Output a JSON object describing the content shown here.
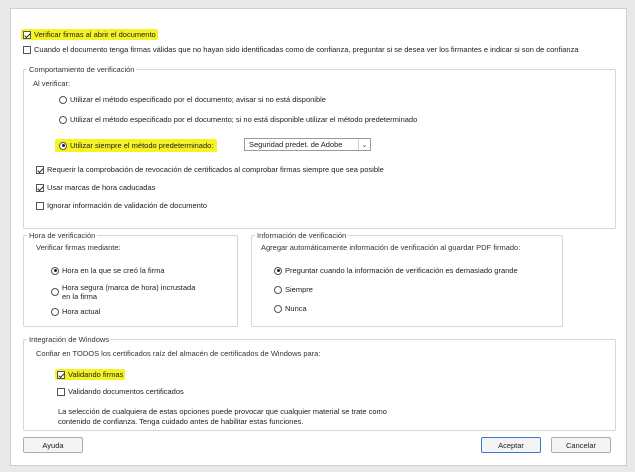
{
  "top_checkbox": {
    "label": "Verificar firmas al abrir el documento",
    "checked": true
  },
  "second_checkbox": {
    "label": "Cuando el documento tenga firmas válidas que no hayan sido identificadas como de confianza, preguntar si se desea ver los firmantes e indicar si son de confianza",
    "checked": false
  },
  "verification_behavior": {
    "title": "Comportamiento de verificación",
    "subtitle": "Al verificar:",
    "options": [
      {
        "label": "Utilizar el método especificado por el documento; avisar si no está disponible",
        "checked": false
      },
      {
        "label": "Utilizar el método especificado por el documento; si no está disponible utilizar el método predeterminado",
        "checked": false
      },
      {
        "label": "Utilizar siempre el método predeterminado:",
        "checked": true
      }
    ],
    "select_value": "Seguridad predet. de Adobe",
    "checkboxes": [
      {
        "label": "Requerir la comprobación de revocación de certificados al comprobar firmas siempre que sea posible",
        "checked": true
      },
      {
        "label": "Usar marcas de hora caducadas",
        "checked": true
      },
      {
        "label": "Ignorar información de validación de documento",
        "checked": false
      }
    ]
  },
  "verification_time": {
    "title": "Hora de verificación",
    "subtitle": "Verificar firmas mediante:",
    "options": [
      {
        "label": "Hora en la que se creó la firma",
        "checked": true
      },
      {
        "label_line1": "Hora segura (marca de hora) incrustada",
        "label_line2": "en la firma",
        "checked": false
      },
      {
        "label": "Hora actual",
        "checked": false
      }
    ]
  },
  "verification_info": {
    "title": "Información de verificación",
    "subtitle": "Agregar automáticamente información de verificación al guardar PDF firmado:",
    "options": [
      {
        "label": "Preguntar cuando la información de verificación es demasiado grande",
        "checked": true
      },
      {
        "label": "Siempre",
        "checked": false
      },
      {
        "label": "Nunca",
        "checked": false
      }
    ]
  },
  "windows_integration": {
    "title": "Integración de Windows",
    "subtitle": "Confiar en TODOS los certificados raíz del almacén de certificados de Windows para:",
    "checkboxes": [
      {
        "label": "Validando firmas",
        "checked": true
      },
      {
        "label": "Validando documentos certificados",
        "checked": false
      }
    ],
    "note_line1": "La selección de cualquiera de estas opciones puede provocar que cualquier material se trate como",
    "note_line2": "contenido de confianza. Tenga cuidado antes de habilitar estas funciones."
  },
  "buttons": {
    "help": "Ayuda",
    "accept": "Aceptar",
    "cancel": "Cancelar"
  },
  "colors": {
    "highlight": "#f5f324",
    "accept_border": "#3c78c9"
  }
}
